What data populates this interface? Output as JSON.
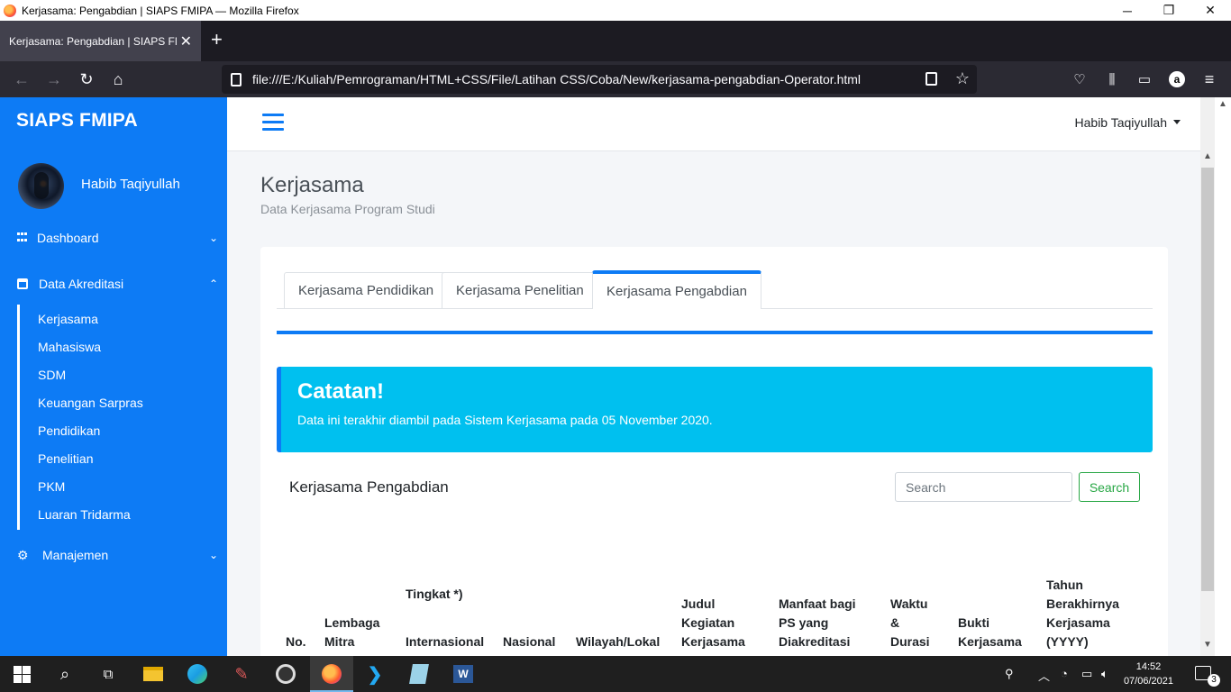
{
  "window": {
    "title": "Kerjasama: Pengabdian | SIAPS FMIPA — Mozilla Firefox",
    "minimize": "─",
    "maximize": "❐",
    "close": "✕"
  },
  "browser": {
    "tab_title": "Kerjasama: Pengabdian | SIAPS FMIPA",
    "tab_close": "✕",
    "new_tab": "+",
    "url": "file:///E:/Kuliah/Pemrograman/HTML+CSS/File/Latihan CSS/Coba/New/kerjasama-pengabdian-Operator.html"
  },
  "sidebar": {
    "brand": "SIAPS FMIPA",
    "user_name": "Habib Taqiyullah",
    "menu": [
      {
        "label": "Dashboard",
        "icon": "grid-icon",
        "caret": "⌄"
      },
      {
        "label": "Data Akreditasi",
        "icon": "calendar-icon",
        "caret": "⌃"
      },
      {
        "label": "Manajemen",
        "icon": "gear-icon",
        "caret": "⌄"
      }
    ],
    "submenu": [
      "Kerjasama",
      "Mahasiswa",
      "SDM",
      "Keuangan Sarpras",
      "Pendidikan",
      "Penelitian",
      "PKM",
      "Luaran Tridarma"
    ]
  },
  "header": {
    "user_name": "Habib Taqiyullah"
  },
  "page": {
    "title": "Kerjasama",
    "subtitle": "Data Kerjasama Program Studi",
    "tabs": [
      "Kerjasama Pendidikan",
      "Kerjasama Penelitian",
      "Kerjasama Pengabdian"
    ],
    "active_tab": "Kerjasama Pengabdian",
    "callout": {
      "title": "Catatan!",
      "text": "Data ini terakhir diambil pada Sistem Kerjasama pada 05 November 2020."
    },
    "section_title": "Kerjasama Pengabdian",
    "search": {
      "placeholder": "Search",
      "button": "Search"
    },
    "table_headers": {
      "no": "No.",
      "lembaga": "Lembaga Mitra",
      "tingkat": "Tingkat *)",
      "internasional": "Internasional",
      "nasional": "Nasional",
      "wilayah": "Wilayah/Lokal",
      "judul": "Judul Kegiatan Kerjasama",
      "manfaat": "Manfaat bagi PS yang Diakreditasi",
      "waktu": "Waktu & Durasi",
      "bukti": "Bukti Kerjasama",
      "tahun": "Tahun Berakhirnya Kerjasama (YYYY)"
    }
  },
  "taskbar": {
    "time": "14:52",
    "date": "07/06/2021",
    "notifications": "3"
  },
  "colors": {
    "primary": "#0d7bf5",
    "info": "#00c0ef",
    "success": "#28a745",
    "page_bg": "#f4f6f9"
  }
}
